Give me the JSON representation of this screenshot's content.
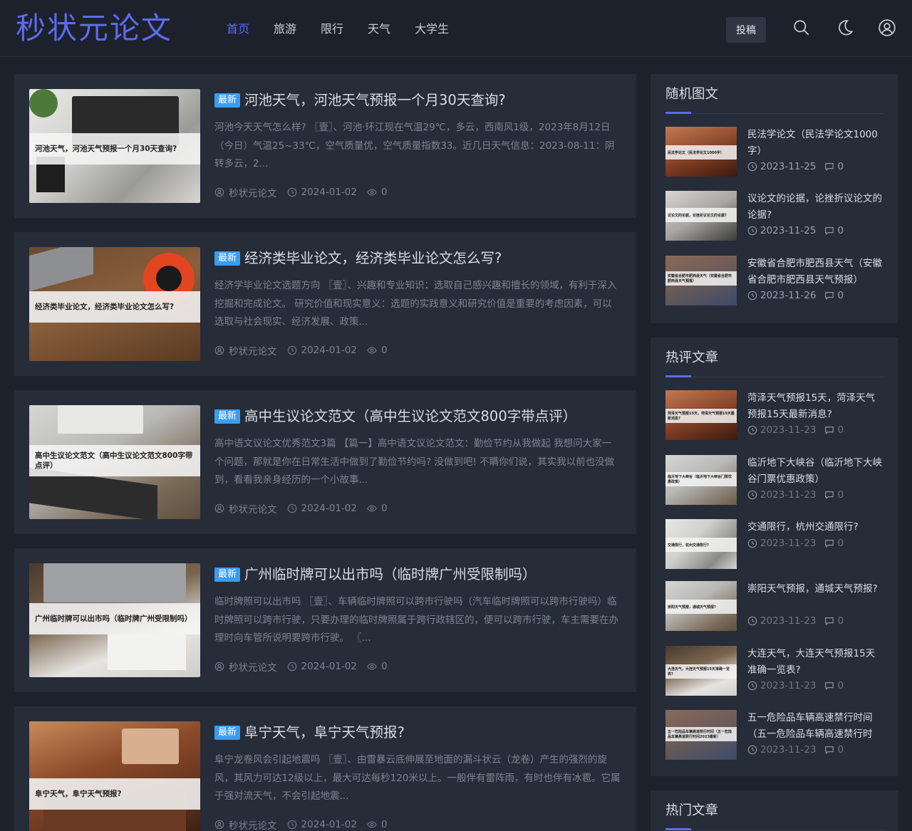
{
  "site": {
    "logo": "秒状元论文"
  },
  "nav": [
    {
      "label": "首页",
      "active": true
    },
    {
      "label": "旅游",
      "active": false
    },
    {
      "label": "限行",
      "active": false
    },
    {
      "label": "天气",
      "active": false
    },
    {
      "label": "大学生",
      "active": false
    }
  ],
  "header": {
    "submit_label": "投稿",
    "icons": [
      "search-icon",
      "moon-icon",
      "user-icon"
    ]
  },
  "colors": {
    "accent": "#5b6cf0",
    "badge": "#3a9df0",
    "bg": "#1c212b",
    "card": "#262c38"
  },
  "posts": [
    {
      "badge": "最新",
      "title": "河池天气，河池天气预报一个月30天查询?",
      "thumb_text": "河池天气，河池天气预报一个月30天查询?",
      "excerpt": "河池今天天气怎么样? 〖壹〗、河池·环江现在气温29℃，多云，西南风1级，2023年8月12日（今日）气温25~33℃，空气质量优，空气质量指数33。近几日天气信息：2023-08-11：阴转多云，2...",
      "author": "秒状元论文",
      "date": "2024-01-02",
      "views": "0"
    },
    {
      "badge": "最新",
      "title": "经济类毕业论文，经济类毕业论文怎么写?",
      "thumb_text": "经济类毕业论文，经济类毕业论文怎么写?",
      "excerpt": "经济学毕业论文选题方向 〖壹〗、兴趣和专业知识：选取自己感兴趣和擅长的领域，有利于深入挖掘和完成论文。 研究价值和现实意义：选题的实践意义和研究价值是重要的考虑因素，可以选取与社会现实、经济发展、政策...",
      "author": "秒状元论文",
      "date": "2024-01-02",
      "views": "0"
    },
    {
      "badge": "最新",
      "title": "高中生议论文范文（高中生议论文范文800字带点评）",
      "thumb_text": "高中生议论文范文（高中生议论文范文800字带点评）",
      "excerpt": "高中语文议论文优秀范文3篇 【篇一】高中语文议论文范文：勤俭节约从我做起 我想问大家一个问题，那就是你在日常生活中做到了勤俭节约吗? 没做到吧! 不瞒你们说，其实我以前也没做到，看看我亲身经历的一个小故事...",
      "author": "秒状元论文",
      "date": "2024-01-02",
      "views": "0"
    },
    {
      "badge": "最新",
      "title": "广州临时牌可以出市吗（临时牌广州受限制吗）",
      "thumb_text": "广州临时牌可以出市吗（临时牌广州受限制吗）",
      "excerpt": "临时牌照可以出市吗 〖壹〗、车辆临时牌照可以跨市行驶吗（汽车临时牌照可以跨市行驶吗）临时牌照可以跨市行驶，只要办理的临时牌照属于跨行政辖区的，便可以跨市行驶，车主需要在办理时向车管所说明要跨市行驶。 〖...",
      "author": "秒状元论文",
      "date": "2024-01-02",
      "views": "0"
    },
    {
      "badge": "最新",
      "title": "阜宁天气，阜宁天气预报?",
      "thumb_text": "阜宁天气，阜宁天气预报?",
      "excerpt": "阜宁龙卷风会引起地震吗 〖壹〗、由雷暴云底伸展至地面的漏斗状云（龙卷）产生的强烈的旋风，其风力可达12级以上，最大可达每秒120米以上。一般伴有雷阵雨，有时也伴有冰雹。它属于强对流天气，不会引起地震...",
      "author": "秒状元论文",
      "date": "2024-01-02",
      "views": "0"
    }
  ],
  "sidebar": {
    "random": {
      "title": "随机图文",
      "items": [
        {
          "title": "民法学论文（民法学论文1000字）",
          "date": "2023-11-25",
          "comments": "0",
          "thumb_text": "民法学论文（民法学论文1000字）"
        },
        {
          "title": "议论文的论据，论挫折议论文的论据?",
          "date": "2023-11-25",
          "comments": "0",
          "thumb_text": "议论文的论据，论挫折议论文的论据?"
        },
        {
          "title": "安徽省合肥市肥西县天气（安徽省合肥市肥西县天气预报）",
          "date": "2023-11-26",
          "comments": "0",
          "thumb_text": "安徽省合肥市肥西县天气（安徽省合肥市肥西县天气预报）"
        }
      ]
    },
    "hot_comments": {
      "title": "热评文章",
      "items": [
        {
          "title": "菏泽天气预报15天，菏泽天气预报15天最新消息?",
          "date": "2023-11-23",
          "comments": "0",
          "thumb_text": "菏泽天气预报15天，菏泽天气预报15天最新消息?"
        },
        {
          "title": "临沂地下大峡谷（临沂地下大峡谷门票优惠政策）",
          "date": "2023-11-23",
          "comments": "0",
          "thumb_text": "临沂地下大峡谷（临沂地下大峡谷门票优惠政策）"
        },
        {
          "title": "交通限行，杭州交通限行?",
          "date": "2023-11-23",
          "comments": "0",
          "thumb_text": "交通限行，杭州交通限行?"
        },
        {
          "title": "崇阳天气预报，通城天气预报?",
          "date": "2023-11-23",
          "comments": "0",
          "thumb_text": "崇阳天气预报，通城天气预报?"
        },
        {
          "title": "大连天气，大连天气预报15天准确一览表?",
          "date": "2023-11-23",
          "comments": "0",
          "thumb_text": "大连天气，大连天气预报15天准确一览表?"
        },
        {
          "title": "五一危险品车辆高速禁行时间（五一危险品车辆高速禁行时",
          "date": "2023-11-23",
          "comments": "0",
          "thumb_text": "五一危险品车辆高速禁行时间（五一危险品车辆高速禁行时间2023最新）"
        }
      ]
    },
    "hot_posts": {
      "title": "热门文章"
    }
  }
}
